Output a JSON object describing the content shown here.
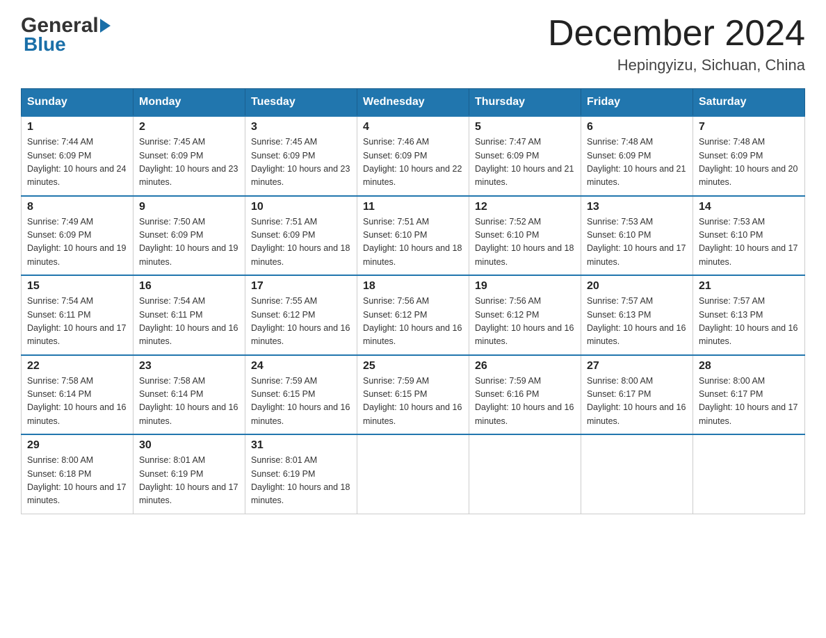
{
  "header": {
    "logo_general": "General",
    "logo_blue": "Blue",
    "month_year": "December 2024",
    "location": "Hepingyizu, Sichuan, China"
  },
  "days_of_week": [
    "Sunday",
    "Monday",
    "Tuesday",
    "Wednesday",
    "Thursday",
    "Friday",
    "Saturday"
  ],
  "weeks": [
    [
      {
        "day": "1",
        "sunrise": "7:44 AM",
        "sunset": "6:09 PM",
        "daylight": "10 hours and 24 minutes."
      },
      {
        "day": "2",
        "sunrise": "7:45 AM",
        "sunset": "6:09 PM",
        "daylight": "10 hours and 23 minutes."
      },
      {
        "day": "3",
        "sunrise": "7:45 AM",
        "sunset": "6:09 PM",
        "daylight": "10 hours and 23 minutes."
      },
      {
        "day": "4",
        "sunrise": "7:46 AM",
        "sunset": "6:09 PM",
        "daylight": "10 hours and 22 minutes."
      },
      {
        "day": "5",
        "sunrise": "7:47 AM",
        "sunset": "6:09 PM",
        "daylight": "10 hours and 21 minutes."
      },
      {
        "day": "6",
        "sunrise": "7:48 AM",
        "sunset": "6:09 PM",
        "daylight": "10 hours and 21 minutes."
      },
      {
        "day": "7",
        "sunrise": "7:48 AM",
        "sunset": "6:09 PM",
        "daylight": "10 hours and 20 minutes."
      }
    ],
    [
      {
        "day": "8",
        "sunrise": "7:49 AM",
        "sunset": "6:09 PM",
        "daylight": "10 hours and 19 minutes."
      },
      {
        "day": "9",
        "sunrise": "7:50 AM",
        "sunset": "6:09 PM",
        "daylight": "10 hours and 19 minutes."
      },
      {
        "day": "10",
        "sunrise": "7:51 AM",
        "sunset": "6:09 PM",
        "daylight": "10 hours and 18 minutes."
      },
      {
        "day": "11",
        "sunrise": "7:51 AM",
        "sunset": "6:10 PM",
        "daylight": "10 hours and 18 minutes."
      },
      {
        "day": "12",
        "sunrise": "7:52 AM",
        "sunset": "6:10 PM",
        "daylight": "10 hours and 18 minutes."
      },
      {
        "day": "13",
        "sunrise": "7:53 AM",
        "sunset": "6:10 PM",
        "daylight": "10 hours and 17 minutes."
      },
      {
        "day": "14",
        "sunrise": "7:53 AM",
        "sunset": "6:10 PM",
        "daylight": "10 hours and 17 minutes."
      }
    ],
    [
      {
        "day": "15",
        "sunrise": "7:54 AM",
        "sunset": "6:11 PM",
        "daylight": "10 hours and 17 minutes."
      },
      {
        "day": "16",
        "sunrise": "7:54 AM",
        "sunset": "6:11 PM",
        "daylight": "10 hours and 16 minutes."
      },
      {
        "day": "17",
        "sunrise": "7:55 AM",
        "sunset": "6:12 PM",
        "daylight": "10 hours and 16 minutes."
      },
      {
        "day": "18",
        "sunrise": "7:56 AM",
        "sunset": "6:12 PM",
        "daylight": "10 hours and 16 minutes."
      },
      {
        "day": "19",
        "sunrise": "7:56 AM",
        "sunset": "6:12 PM",
        "daylight": "10 hours and 16 minutes."
      },
      {
        "day": "20",
        "sunrise": "7:57 AM",
        "sunset": "6:13 PM",
        "daylight": "10 hours and 16 minutes."
      },
      {
        "day": "21",
        "sunrise": "7:57 AM",
        "sunset": "6:13 PM",
        "daylight": "10 hours and 16 minutes."
      }
    ],
    [
      {
        "day": "22",
        "sunrise": "7:58 AM",
        "sunset": "6:14 PM",
        "daylight": "10 hours and 16 minutes."
      },
      {
        "day": "23",
        "sunrise": "7:58 AM",
        "sunset": "6:14 PM",
        "daylight": "10 hours and 16 minutes."
      },
      {
        "day": "24",
        "sunrise": "7:59 AM",
        "sunset": "6:15 PM",
        "daylight": "10 hours and 16 minutes."
      },
      {
        "day": "25",
        "sunrise": "7:59 AM",
        "sunset": "6:15 PM",
        "daylight": "10 hours and 16 minutes."
      },
      {
        "day": "26",
        "sunrise": "7:59 AM",
        "sunset": "6:16 PM",
        "daylight": "10 hours and 16 minutes."
      },
      {
        "day": "27",
        "sunrise": "8:00 AM",
        "sunset": "6:17 PM",
        "daylight": "10 hours and 16 minutes."
      },
      {
        "day": "28",
        "sunrise": "8:00 AM",
        "sunset": "6:17 PM",
        "daylight": "10 hours and 17 minutes."
      }
    ],
    [
      {
        "day": "29",
        "sunrise": "8:00 AM",
        "sunset": "6:18 PM",
        "daylight": "10 hours and 17 minutes."
      },
      {
        "day": "30",
        "sunrise": "8:01 AM",
        "sunset": "6:19 PM",
        "daylight": "10 hours and 17 minutes."
      },
      {
        "day": "31",
        "sunrise": "8:01 AM",
        "sunset": "6:19 PM",
        "daylight": "10 hours and 18 minutes."
      },
      null,
      null,
      null,
      null
    ]
  ]
}
